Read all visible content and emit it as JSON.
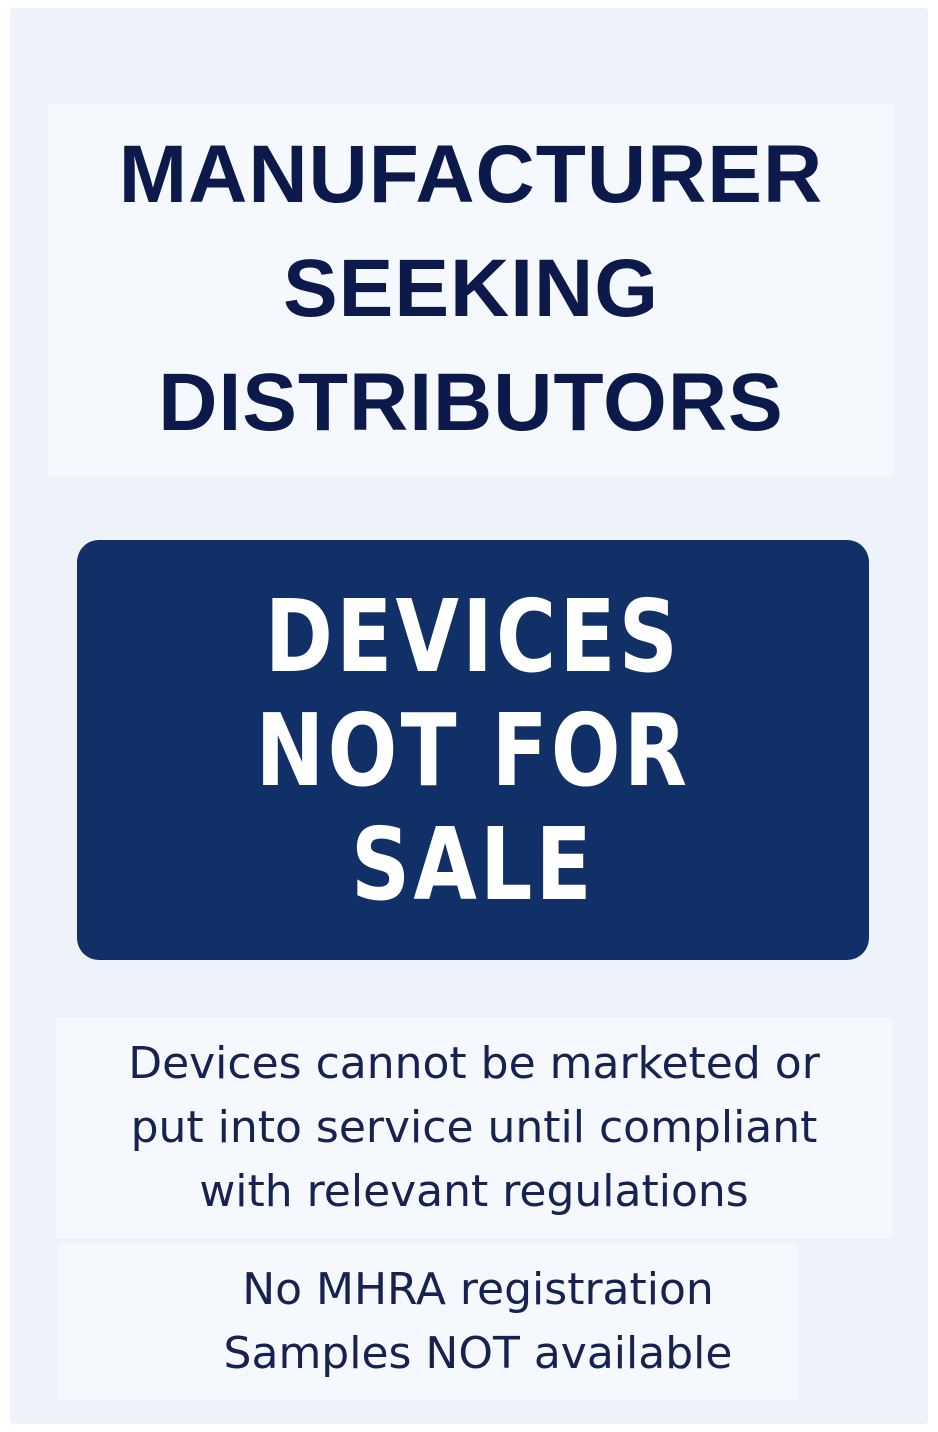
{
  "heading": {
    "lines": [
      "MANUFACTURER",
      "SEEKING",
      "DISTRIBUTORS"
    ]
  },
  "banner": {
    "lines": [
      "DEVICES",
      "NOT FOR",
      "SALE"
    ],
    "background_color": "#113068",
    "text_color": "#ffffff"
  },
  "notice": {
    "lines": [
      "Devices cannot be marketed or",
      "put into service until compliant",
      "with relevant regulations"
    ]
  },
  "status": {
    "lines": [
      "No MHRA registration",
      "Samples NOT available"
    ]
  },
  "colors": {
    "text_dark": "#0b1a4a",
    "page_background": "#eef2fa"
  }
}
